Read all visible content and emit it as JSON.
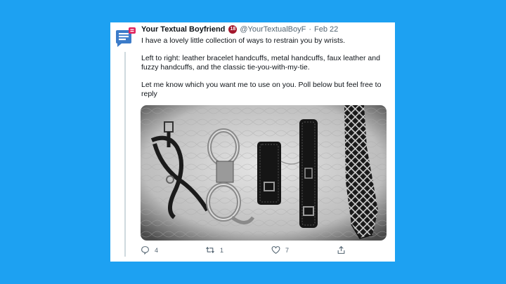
{
  "tweet": {
    "author_name": "Your Textual Boyfriend",
    "age_badge": "18",
    "handle": "@YourTextualBoyF",
    "separator": "·",
    "date": "Feb 22",
    "paragraphs": [
      "I have a lovely little collection of ways to restrain you by wrists.",
      "Left to right: leather bracelet handcuffs, metal handcuffs, faux leather and fuzzy handcuffs, and the classic tie-you-with-my-tie.",
      "Let me know which you want me to use on you. Poll below but feel free to reply"
    ],
    "actions": {
      "reply_count": "4",
      "retweet_count": "1",
      "like_count": "7"
    }
  },
  "colors": {
    "page_background": "#1da1f2",
    "card_background": "#ffffff",
    "badge_red": "#a3172d",
    "text_secondary": "#536471"
  },
  "icons": [
    "avatar-icon",
    "reply-icon",
    "retweet-icon",
    "like-icon",
    "share-icon"
  ]
}
